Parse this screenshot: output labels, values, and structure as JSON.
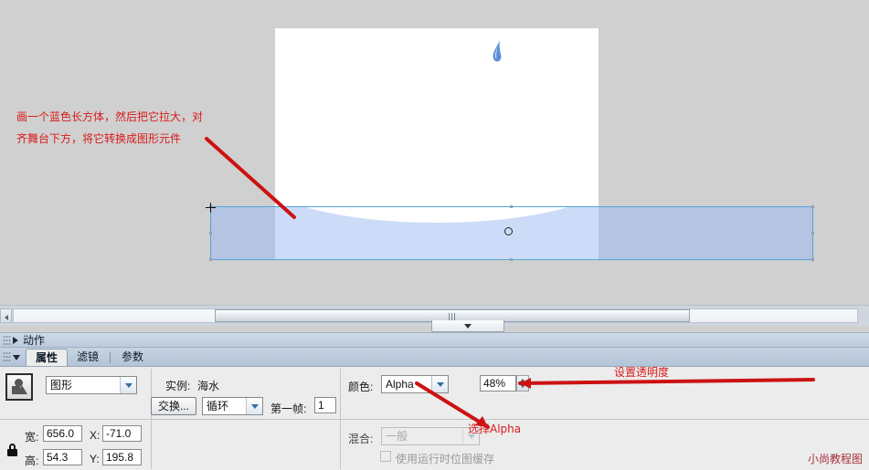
{
  "stage": {
    "instance_name_on_canvas": "",
    "droplet_icon": "water-droplet",
    "registration_point_icon": "registration-point"
  },
  "annotations": [
    {
      "id": "draw-rect-note",
      "text_line1": "画一个蓝色长方体，然后把它拉大，对",
      "text_line2": "齐舞台下方，将它转换成图形元件"
    },
    {
      "id": "set-alpha-note",
      "text": "设置透明度"
    },
    {
      "id": "choose-alpha-note",
      "text": "选择Alpha"
    }
  ],
  "watermark": {
    "text": "小尚教程图"
  },
  "actions_panel": {
    "title": "动作",
    "disclosure_icon": "triangle-right-icon"
  },
  "properties_panel": {
    "disclosure_icon": "triangle-down-icon",
    "tabs": [
      {
        "label": "属性",
        "active": true
      },
      {
        "label": "滤镜",
        "active": false
      },
      {
        "label": "参数",
        "active": false
      }
    ],
    "symbol_type": {
      "icon": "graphic-symbol-icon",
      "value": "图形",
      "dropdown_icon": "chevron-down-icon"
    },
    "instance": {
      "label": "实例:",
      "value": "海水"
    },
    "swap_button": {
      "label": "交换..."
    },
    "loop_mode": {
      "value": "循环",
      "dropdown_icon": "chevron-down-icon"
    },
    "first_frame": {
      "label": "第一帧:",
      "value": "1"
    },
    "color": {
      "label": "颜色:",
      "value": "Alpha",
      "dropdown_icon": "chevron-down-icon",
      "amount": "48%",
      "stepper_icon": "spinner-icon"
    },
    "blend": {
      "label": "混合:",
      "value": "一般",
      "disabled": true,
      "dropdown_icon": "chevron-down-icon"
    },
    "bitmap_cache": {
      "label": "使用运行时位图缓存",
      "checked": false,
      "disabled": true
    },
    "geometry": {
      "lock_icon": "lock-icon",
      "width_label": "宽:",
      "width_value": "656.0",
      "height_label": "高:",
      "height_value": "54.3",
      "x_label": "X:",
      "x_value": "-71.0",
      "y_label": "Y:",
      "y_value": "195.8"
    }
  },
  "timeline_scroll": {
    "left_arrow_icon": "arrow-left-icon",
    "thumb_grip_icon": "grip-icon",
    "collapse_icon": "triangle-down-icon"
  },
  "colors": {
    "water_dark": "#b4c4e2",
    "water_light": "#ccdcf8",
    "selection_border": "#53a4d6",
    "annotation_red": "#d91b1b",
    "watermark_red": "#a8303a",
    "droplet_blue": "#4a7fd4"
  }
}
